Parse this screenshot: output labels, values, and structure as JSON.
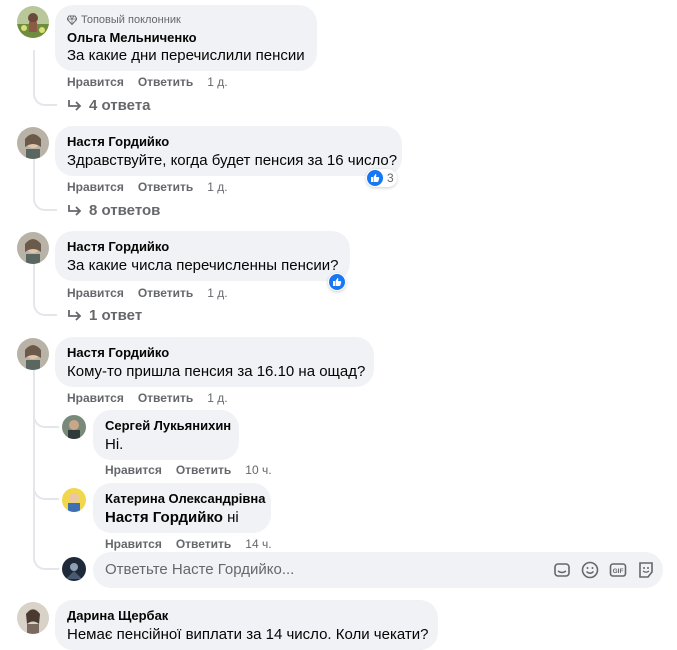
{
  "comments": [
    {
      "badge": "Топовый поклонник",
      "author": "Ольга Мельниченко",
      "text": "За какие дни перечислили пенсии",
      "like": "Нравится",
      "reply": "Ответить",
      "time": "1 д.",
      "replies": "4 ответа"
    },
    {
      "author": "Настя Гордийко",
      "text": "Здравствуйте, когда будет пенсия за 16 число?",
      "like": "Нравится",
      "reply": "Ответить",
      "time": "1 д.",
      "reactions": "3",
      "replies": "8 ответов"
    },
    {
      "author": "Настя Гордийко",
      "text": "За какие числа перечисленны пенсии?",
      "like": "Нравится",
      "reply": "Ответить",
      "time": "1 д.",
      "replies": "1 ответ"
    },
    {
      "author": "Настя Гордийко",
      "text": "Кому-то пришла пенсия за 16.10 на ощад?",
      "like": "Нравится",
      "reply": "Ответить",
      "time": "1 д."
    },
    {
      "author": "Дарина Щербак",
      "text": "Немає пенсійної виплати за 14 число. Коли чекати?"
    }
  ],
  "nested": [
    {
      "author": "Сергей Лукьянихин",
      "text": "Ні.",
      "like": "Нравится",
      "reply": "Ответить",
      "time": "10 ч."
    },
    {
      "author": "Катерина Олександрівна",
      "mention": "Настя Гордийко",
      "text": " ні",
      "like": "Нравится",
      "reply": "Ответить",
      "time": "14 ч."
    }
  ],
  "reply_box": {
    "placeholder": "Ответьте Насте Гордийко...",
    "icons": [
      "sticker-icon",
      "emoji-icon",
      "gif-icon",
      "avatar-sticker-icon"
    ]
  },
  "colors": {
    "bubble": "#f0f2f5",
    "secondary_text": "#65676b",
    "like_blue": "#1877f2",
    "thread_line": "#e4e6eb"
  }
}
